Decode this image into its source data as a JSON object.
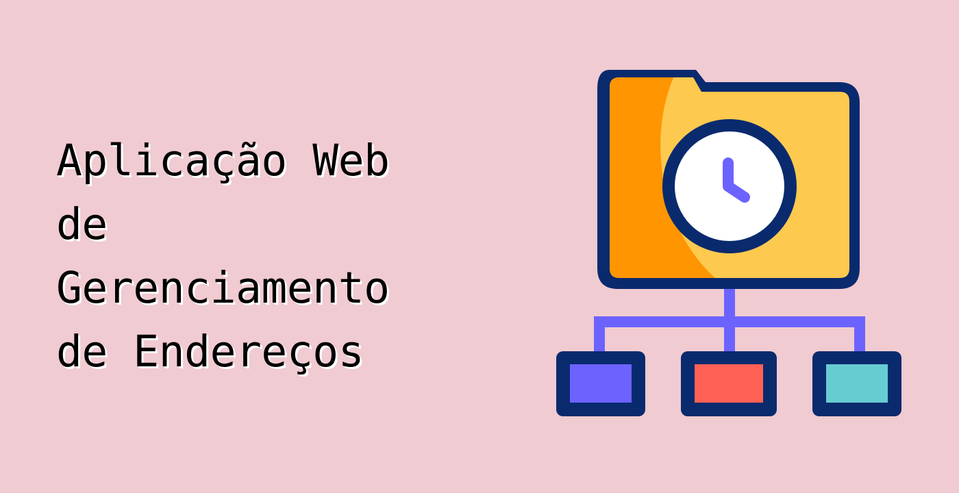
{
  "title": {
    "lines": [
      "Aplicação Web",
      "de",
      "Gerenciamento",
      "de Endereços"
    ]
  },
  "illustration": {
    "icon": "folder-clock-network-icon",
    "colors": {
      "background": "#F0CBD1",
      "outline": "#0A2A6E",
      "folder_front": "#FDC94F",
      "folder_shade": "#FF9500",
      "clock_face": "#FFFFFF",
      "clock_hands": "#6C63FF",
      "connector": "#6C63FF",
      "node_left": "#6C63FF",
      "node_center": "#FF6155",
      "node_right": "#66CCD2"
    }
  }
}
